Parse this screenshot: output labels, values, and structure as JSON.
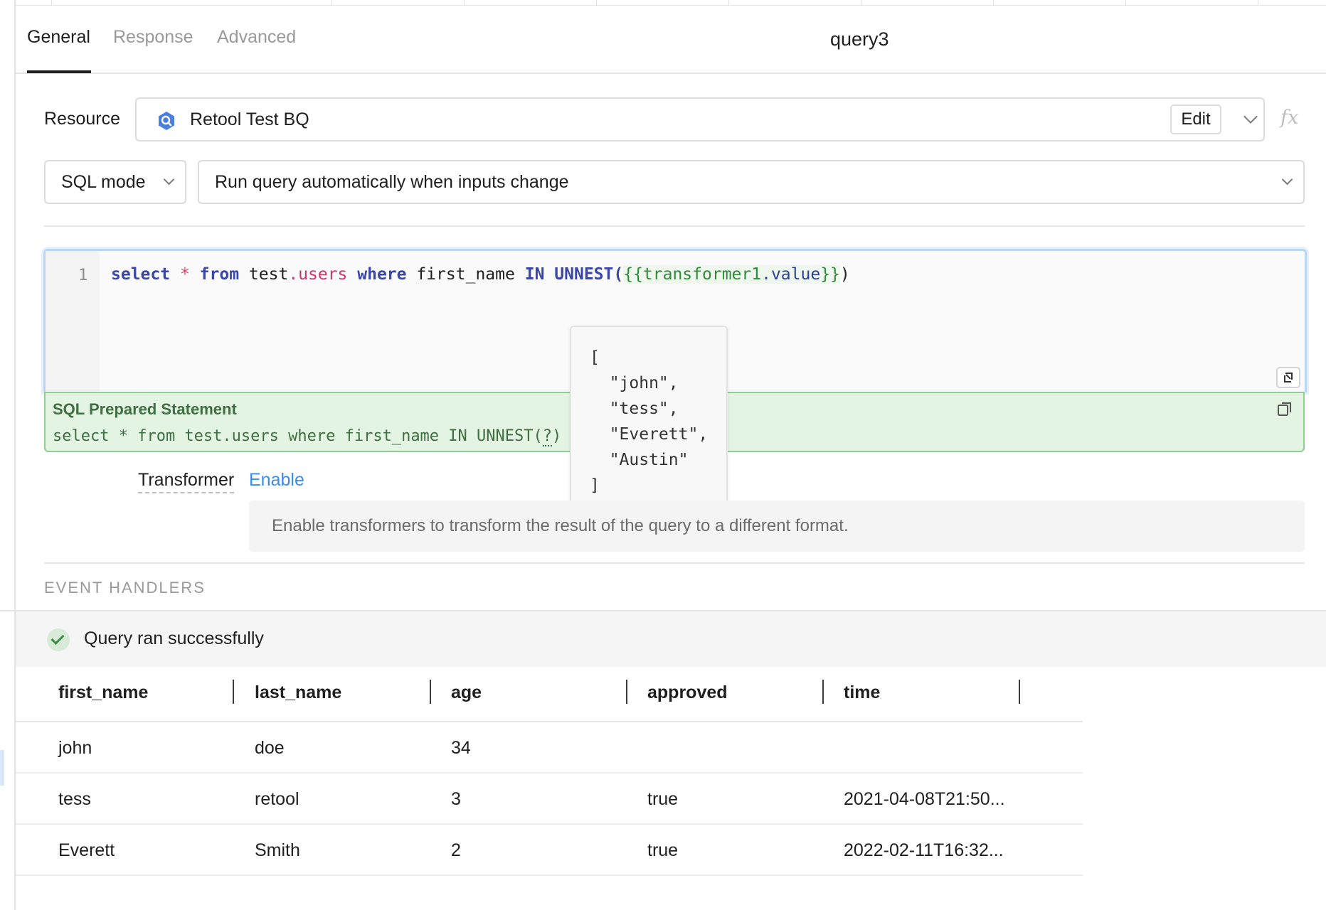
{
  "tabs": [
    {
      "label": "General",
      "active": true
    },
    {
      "label": "Response",
      "active": false
    },
    {
      "label": "Advanced",
      "active": false
    }
  ],
  "query_name": "query3",
  "resource": {
    "label": "Resource",
    "name": "Retool Test BQ",
    "icon": "bigquery-icon",
    "edit_label": "Edit",
    "fx_label": "fx"
  },
  "mode_select": {
    "value": "SQL mode"
  },
  "run_select": {
    "value": "Run query automatically when inputs change"
  },
  "editor": {
    "line_number": "1",
    "tokens": {
      "select": "select",
      "star": "*",
      "from": "from",
      "schema": "test",
      "table": ".users",
      "where": "where",
      "column": "first_name",
      "in": "IN",
      "unnest": "UNNEST(",
      "open_brace": "{{",
      "transformer": "transformer1",
      "value": ".value",
      "close_brace": "}}",
      "close_paren": ")"
    }
  },
  "prepared_statement": {
    "title": "SQL Prepared Statement",
    "code_before": "select * from test.users where first_name IN UNNEST(",
    "placeholder": "?",
    "code_after": ")"
  },
  "tooltip": {
    "lines": [
      "[",
      "  \"john\",",
      "  \"tess\",",
      "  \"Everett\",",
      "  \"Austin\"",
      "]"
    ]
  },
  "transformer": {
    "label": "Transformer",
    "enable_label": "Enable",
    "description": "Enable transformers to transform the result of the query to a different format."
  },
  "event_handlers_label": "EVENT HANDLERS",
  "status": {
    "text": "Query ran successfully",
    "color": "#3f8a45"
  },
  "results": {
    "columns": [
      "first_name",
      "last_name",
      "age",
      "approved",
      "time"
    ],
    "rows": [
      [
        "john",
        "doe",
        "34",
        "",
        ""
      ],
      [
        "tess",
        "retool",
        "3",
        "true",
        "2021-04-08T21:50..."
      ],
      [
        "Everett",
        "Smith",
        "2",
        "true",
        "2022-02-11T16:32..."
      ]
    ]
  }
}
